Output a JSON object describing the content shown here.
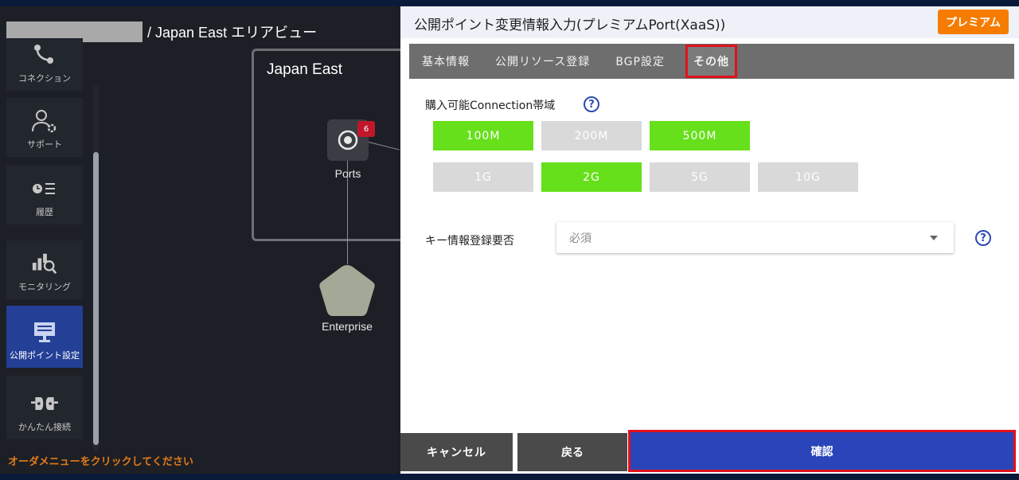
{
  "breadcrumb": {
    "text": "/ Japan East エリアビュー"
  },
  "sidebar": {
    "items": [
      {
        "label": "コネクション",
        "icon": "connection-icon"
      },
      {
        "label": "サポート",
        "icon": "support-user-gear-icon"
      },
      {
        "label": "履歴",
        "icon": "history-list-icon"
      },
      {
        "label": "モニタリング",
        "icon": "monitoring-chart-icon"
      },
      {
        "label": "公開ポイント設定",
        "icon": "monitor-icon",
        "active": true
      },
      {
        "label": "かんたん接続",
        "icon": "plug-icon"
      }
    ]
  },
  "order_message": "オーダメニューをクリックしてください",
  "map": {
    "region_title": "Japan East",
    "ports_label": "Ports",
    "ports_badge": "6",
    "enterprise_label": "Enterprise"
  },
  "panel": {
    "title": "公開ポイント変更情報入力(プレミアムPort(XaaS))",
    "premium_badge": "プレミアム",
    "tabs": [
      {
        "label": "基本情報"
      },
      {
        "label": "公開リソース登録"
      },
      {
        "label": "BGP設定"
      },
      {
        "label": "その他",
        "active": true
      }
    ],
    "bandwidth_label": "購入可能Connection帯域",
    "bandwidth_options": [
      {
        "label": "100M",
        "selected": true
      },
      {
        "label": "200M",
        "selected": false
      },
      {
        "label": "500M",
        "selected": true
      },
      {
        "label": "1G",
        "selected": false
      },
      {
        "label": "2G",
        "selected": true
      },
      {
        "label": "5G",
        "selected": false
      },
      {
        "label": "10G",
        "selected": false
      }
    ],
    "key_label": "キー情報登録要否",
    "key_value": "必須",
    "help_glyph": "?"
  },
  "actions": {
    "cancel": "キャンセル",
    "back": "戻る",
    "confirm": "確認"
  },
  "colors": {
    "selected_green": "#66e01a",
    "unselected_gray": "#d9d9d9",
    "confirm_blue": "#2a45b9",
    "premium_orange": "#f57c00",
    "highlight_red": "#e0121d"
  }
}
